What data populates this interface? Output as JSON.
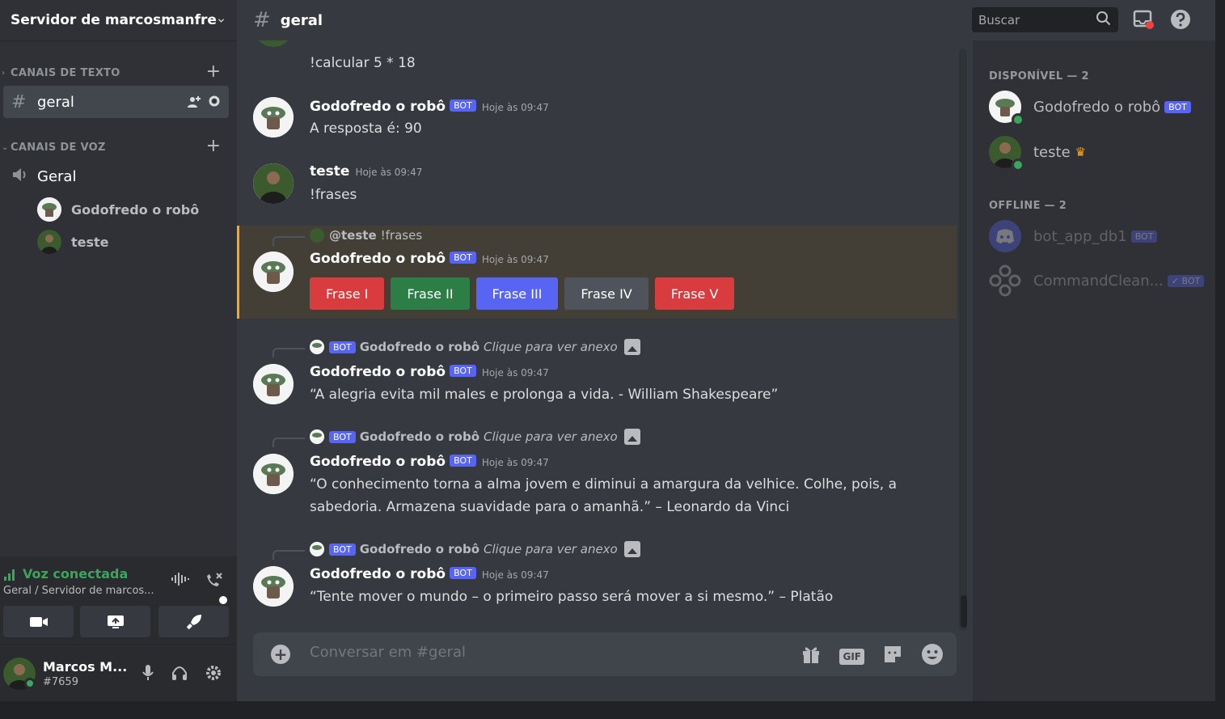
{
  "server": {
    "name": "Servidor de marcosmanfre"
  },
  "sidebar": {
    "text_category": "CANAIS DE TEXTO",
    "voice_category": "CANAIS DE VOZ",
    "text_channel": "geral",
    "voice_channel": "Geral",
    "voice_users": [
      "Godofredo o robô",
      "teste"
    ]
  },
  "voice_panel": {
    "status": "Voz conectada",
    "location": "Geral / Servidor de marcos..."
  },
  "user_panel": {
    "username": "Marcos M...",
    "tag": "#7659"
  },
  "topbar": {
    "channel": "geral",
    "search_placeholder": "Buscar"
  },
  "messages": {
    "m0": {
      "text": "!calcular 5 * 18"
    },
    "m1": {
      "author": "Godofredo o robô",
      "badge": "BOT",
      "time": "Hoje às 09:47",
      "text": "A resposta é: 90"
    },
    "m2": {
      "author": "teste",
      "time": "Hoje às 09:47",
      "text": "!frases"
    },
    "m3": {
      "reply_name": "@teste",
      "reply_text": "!frases",
      "author": "Godofredo o robô",
      "badge": "BOT",
      "time": "Hoje às 09:47",
      "buttons": [
        "Frase I",
        "Frase II",
        "Frase III",
        "Frase IV",
        "Frase V"
      ]
    },
    "m4": {
      "reply_badge": "BOT",
      "reply_name": "Godofredo o robô",
      "reply_text": "Clique para ver anexo",
      "author": "Godofredo o robô",
      "badge": "BOT",
      "time": "Hoje às 09:47",
      "text": "“A alegria evita mil males e prolonga a vida. - William Shakespeare”"
    },
    "m5": {
      "reply_badge": "BOT",
      "reply_name": "Godofredo o robô",
      "reply_text": "Clique para ver anexo",
      "author": "Godofredo o robô",
      "badge": "BOT",
      "time": "Hoje às 09:47",
      "text": "“O conhecimento torna a alma jovem e diminui a amargura da velhice. Colhe, pois, a sabedoria. Armazena suavidade para o amanhã.” – Leonardo da Vinci"
    },
    "m6": {
      "reply_badge": "BOT",
      "reply_name": "Godofredo o robô",
      "reply_text": "Clique para ver anexo",
      "author": "Godofredo o robô",
      "badge": "BOT",
      "time": "Hoje às 09:47",
      "text": "“Tente mover o mundo – o primeiro passo será mover a si mesmo.” – Platão"
    }
  },
  "composer": {
    "placeholder": "Conversar em #geral"
  },
  "members": {
    "online_header": "DISPONÍVEL — 2",
    "offline_header": "OFFLINE — 2",
    "online": [
      {
        "name": "Godofredo o robô",
        "badge": "BOT"
      },
      {
        "name": "teste"
      }
    ],
    "offline": [
      {
        "name": "bot_app_db1",
        "badge": "BOT"
      },
      {
        "name": "CommandClean...",
        "badge": "✓ BOT"
      }
    ]
  },
  "colors": {
    "accent": "#5865f2",
    "online": "#3ba55d",
    "highlight_border": "#faa81a",
    "red": "#d83c3e",
    "green": "#2d7d46",
    "grey": "#4f545c"
  },
  "icons": [
    "chevron-down-icon",
    "hash-icon",
    "add-icon",
    "invite-icon",
    "gear-icon",
    "speaker-icon",
    "signal-icon",
    "soundwave-icon",
    "disconnect-icon",
    "camera-icon",
    "screenshare-icon",
    "rocket-icon",
    "mic-icon",
    "headphones-icon",
    "threads-icon",
    "bell-icon",
    "pin-icon",
    "members-icon",
    "search-icon",
    "inbox-icon",
    "help-icon",
    "gift-icon",
    "gif-icon",
    "sticker-icon",
    "emoji-icon",
    "crown-icon",
    "image-icon"
  ]
}
